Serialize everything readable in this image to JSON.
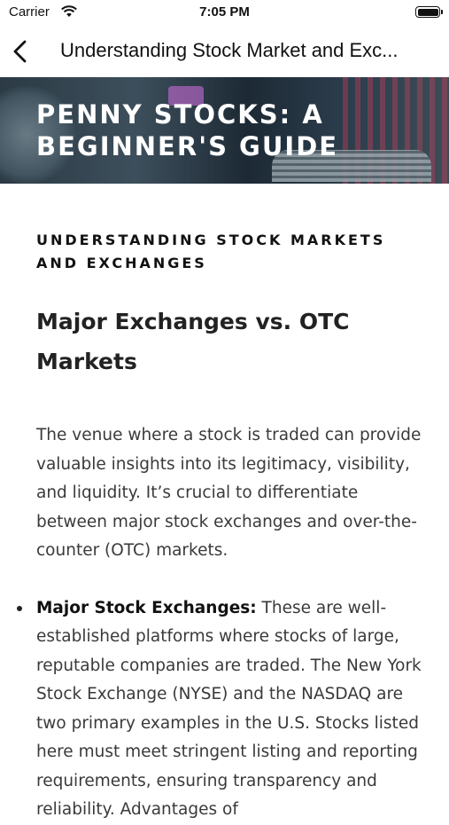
{
  "status_bar": {
    "carrier": "Carrier",
    "time": "7:05 PM"
  },
  "nav": {
    "title": "Understanding Stock Market and Exc..."
  },
  "hero": {
    "title": "PENNY STOCKS: A BEGINNER'S GUIDE"
  },
  "article": {
    "kicker": "UNDERSTANDING STOCK MARKETS AND EXCHANGES",
    "heading": "Major Exchanges vs. OTC Markets",
    "intro": "The venue where a stock is traded can provide valuable insights into its legitimacy, visibility, and liquidity. It’s crucial to differentiate between major stock exchanges and over-the-counter (OTC) markets.",
    "bullets": [
      {
        "label": "Major Stock Exchanges:",
        "text": " These are well-established platforms where stocks of large, reputable companies are traded. The New York Stock Exchange (NYSE) and the NASDAQ are two primary examples in the U.S. Stocks listed here must meet stringent listing and reporting requirements, ensuring transparency and reliability. Advantages of"
      }
    ]
  }
}
